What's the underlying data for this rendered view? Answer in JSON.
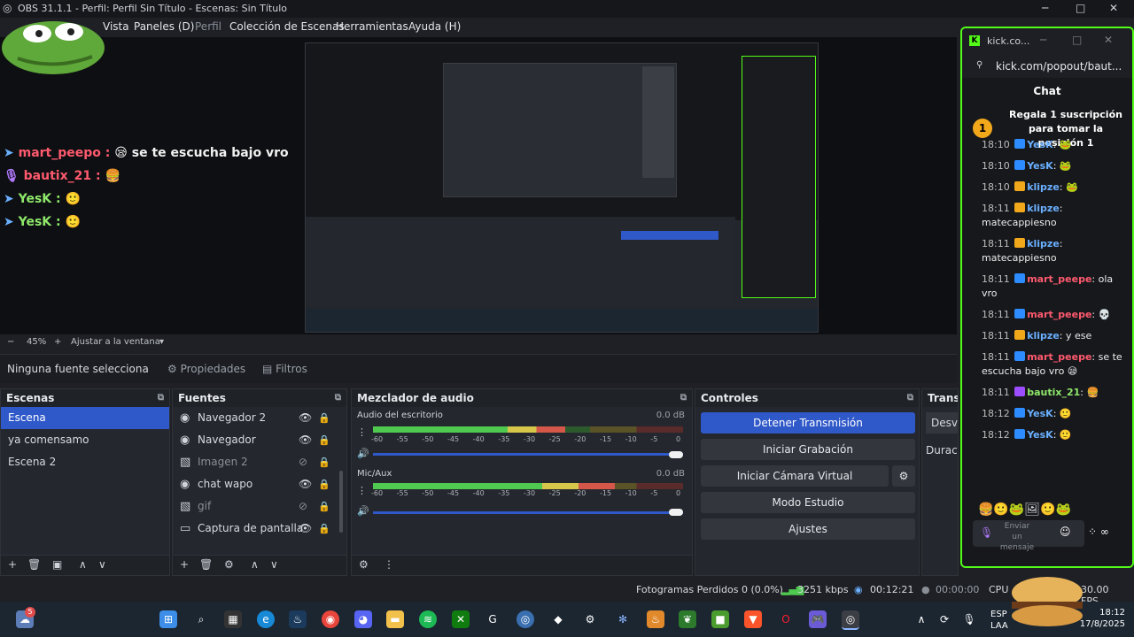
{
  "window": {
    "title": "OBS 31.1.1 - Perfil: Perfil Sin Título - Escenas: Sin Título",
    "controls": {
      "minimize": "─",
      "maximize": "□",
      "close": "✕"
    }
  },
  "menu": [
    "Vista",
    "Paneles (D)",
    "Perfil",
    "Colección de Escenas",
    "Herramientas",
    "Ayuda (H)"
  ],
  "preview_chat": [
    {
      "name": "mart_peepo",
      "sep": " :",
      "text": " se te escucha bajo vro",
      "color": "red"
    },
    {
      "name": "bautix_21",
      "sep": " :",
      "text": "",
      "color": "red"
    },
    {
      "name": "YesK",
      "sep": " :",
      "text": "",
      "color": "green"
    },
    {
      "name": "YesK",
      "sep": " :",
      "text": "",
      "color": "green"
    }
  ],
  "zoom": {
    "minus": "−",
    "value": "45%",
    "plus": "+",
    "fit_label": "Ajustar a la ventana",
    "arrow": "▾"
  },
  "source_bar": {
    "none_selected": "Ninguna fuente selecciona",
    "properties": "Propiedades",
    "filters": "Filtros"
  },
  "scenes": {
    "title": "Escenas",
    "items": [
      "Escena",
      "ya comensamo",
      "Escena 2"
    ],
    "selected": 0,
    "toolbar": [
      "+",
      "🗑",
      "▣",
      "∧",
      "∨"
    ]
  },
  "sources": {
    "title": "Fuentes",
    "items": [
      {
        "label": "Navegador 2",
        "icon": "globe-icon",
        "glyph": "◉",
        "visible": true
      },
      {
        "label": "Navegador",
        "icon": "globe-icon",
        "glyph": "◉",
        "visible": true
      },
      {
        "label": "Imagen 2",
        "icon": "image-icon",
        "glyph": "▧",
        "visible": false
      },
      {
        "label": "chat wapo",
        "icon": "globe-icon",
        "glyph": "◉",
        "visible": true
      },
      {
        "label": "gif",
        "icon": "image-icon",
        "glyph": "▧",
        "visible": false
      },
      {
        "label": "Captura de pantalla",
        "icon": "monitor-icon",
        "glyph": "▭",
        "visible": true
      }
    ],
    "toolbar": [
      "+",
      "🗑",
      "⚙",
      "∧",
      "∨"
    ]
  },
  "mixer": {
    "title": "Mezclador de audio",
    "tracks": [
      {
        "name": "Audio del escritorio",
        "db": "0.0 dB",
        "level": 0.62
      },
      {
        "name": "Mic/Aux",
        "db": "0.0 dB",
        "level": 0.78
      }
    ],
    "ticks": [
      "-60",
      "-55",
      "-50",
      "-45",
      "-40",
      "-35",
      "-30",
      "-25",
      "-20",
      "-15",
      "-10",
      "-5",
      "0"
    ],
    "toolbar": [
      "⚙",
      "⋮"
    ]
  },
  "controls": {
    "title": "Controles",
    "buttons": [
      "Detener Transmisión",
      "Iniciar Grabación",
      "Iniciar Cámara Virtual",
      "Modo Estudio",
      "Ajustes"
    ]
  },
  "transitions": {
    "title": "Transic",
    "mode": "Desva",
    "duration": "Duració"
  },
  "status": {
    "dropped": "Fotogramas Perdidos 0 (0.0%)",
    "bitrate": "3251 kbps",
    "stream_time": "00:12:21",
    "rec_time": "00:00:00",
    "cpu": "CPU",
    "fps": "30.00 FPS"
  },
  "browser": {
    "tab": "kick.co...",
    "url": "kick.com/popout/baut...",
    "chat_title": "Chat",
    "gift_number": "1",
    "gift_text": "Regala 1 suscripción para tomar la posición 1",
    "messages": [
      {
        "time": "18:10",
        "name": "YesK",
        "badge": "blue",
        "color": "blue",
        "text": ":"
      },
      {
        "time": "18:10",
        "name": "YesK",
        "badge": "blue",
        "color": "blue",
        "text": ":"
      },
      {
        "time": "18:10",
        "name": "klipze",
        "badge": "gold",
        "color": "blue",
        "text": ":"
      },
      {
        "time": "18:11",
        "name": "klipze",
        "badge": "gold",
        "color": "blue",
        "text": ": matecappiesno"
      },
      {
        "time": "18:11",
        "name": "klipze",
        "badge": "gold",
        "color": "blue",
        "text": ": matecappiesno"
      },
      {
        "time": "18:11",
        "name": "mart_peepe",
        "badge": "blue",
        "color": "red",
        "text": ": ola vro"
      },
      {
        "time": "18:11",
        "name": "mart_peepe",
        "badge": "blue",
        "color": "red",
        "text": ":"
      },
      {
        "time": "18:11",
        "name": "klipze",
        "badge": "gold",
        "color": "blue",
        "text": ": y ese"
      },
      {
        "time": "18:11",
        "name": "mart_peepe",
        "badge": "blue",
        "color": "red",
        "text": ": se te escucha bajo vro"
      },
      {
        "time": "18:11",
        "name": "bautix_21",
        "badge": "purple",
        "color": "green",
        "text": ":"
      },
      {
        "time": "18:12",
        "name": "YesK",
        "badge": "blue",
        "color": "blue",
        "text": ":"
      },
      {
        "time": "18:12",
        "name": "YesK",
        "badge": "blue",
        "color": "blue",
        "text": ":"
      }
    ],
    "input_placeholder": "Enviar un mensaje"
  },
  "taskbar": {
    "lang": "ESP",
    "lang2": "LAA",
    "time": "18:12",
    "date": "17/8/2025",
    "notification_count": "5"
  }
}
